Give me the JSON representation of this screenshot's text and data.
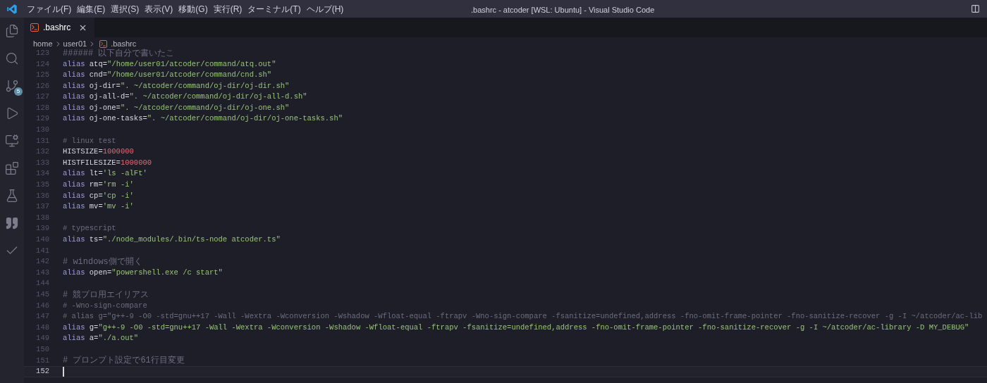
{
  "menu": [
    "ファイル(F)",
    "編集(E)",
    "選択(S)",
    "表示(V)",
    "移動(G)",
    "実行(R)",
    "ターミナル(T)",
    "ヘルプ(H)"
  ],
  "window": {
    "title": ".bashrc - atcoder [WSL: Ubuntu] - Visual Studio Code"
  },
  "activity_bar": [
    {
      "kind": "files"
    },
    {
      "kind": "search"
    },
    {
      "kind": "source-control",
      "badge": "5"
    },
    {
      "kind": "run"
    },
    {
      "kind": "remote"
    },
    {
      "kind": "extensions"
    },
    {
      "kind": "flask"
    },
    {
      "kind": "quote"
    },
    {
      "kind": "check"
    }
  ],
  "tabs": [
    {
      "label": ".bashrc",
      "selected": true
    }
  ],
  "breadcrumb": [
    "home",
    "user01",
    ".bashrc"
  ],
  "lines": [
    {
      "number": "123",
      "current": false,
      "tokens": [
        {
          "kind": "comment",
          "text": "###### 以下自分で書いたこ"
        }
      ]
    },
    {
      "number": "124",
      "current": false,
      "tokens": [
        {
          "kind": "keyword",
          "text": "alias"
        },
        {
          "kind": "name",
          "text": " atq="
        },
        {
          "kind": "string",
          "text": "\"/home/user01/atcoder/command/atq.out\""
        }
      ]
    },
    {
      "number": "125",
      "current": false,
      "tokens": [
        {
          "kind": "keyword",
          "text": "alias"
        },
        {
          "kind": "name",
          "text": " cnd="
        },
        {
          "kind": "string",
          "text": "\"/home/user01/atcoder/command/cnd.sh\""
        }
      ]
    },
    {
      "number": "126",
      "current": false,
      "tokens": [
        {
          "kind": "keyword",
          "text": "alias"
        },
        {
          "kind": "name",
          "text": " oj-dir="
        },
        {
          "kind": "string",
          "text": "\". ~/atcoder/command/oj-dir/oj-dir.sh\""
        }
      ]
    },
    {
      "number": "127",
      "current": false,
      "tokens": [
        {
          "kind": "keyword",
          "text": "alias"
        },
        {
          "kind": "name",
          "text": " oj-all-d="
        },
        {
          "kind": "string",
          "text": "\". ~/atcoder/command/oj-dir/oj-all-d.sh\""
        }
      ]
    },
    {
      "number": "128",
      "current": false,
      "tokens": [
        {
          "kind": "keyword",
          "text": "alias"
        },
        {
          "kind": "name",
          "text": " oj-one="
        },
        {
          "kind": "string",
          "text": "\". ~/atcoder/command/oj-dir/oj-one.sh\""
        }
      ]
    },
    {
      "number": "129",
      "current": false,
      "tokens": [
        {
          "kind": "keyword",
          "text": "alias"
        },
        {
          "kind": "name",
          "text": " oj-one-tasks="
        },
        {
          "kind": "string",
          "text": "\". ~/atcoder/command/oj-dir/oj-one-tasks.sh\""
        }
      ]
    },
    {
      "number": "130",
      "current": false
    },
    {
      "number": "131",
      "current": false,
      "tokens": [
        {
          "kind": "comment",
          "text": "# linux test"
        }
      ]
    },
    {
      "number": "132",
      "current": false,
      "tokens": [
        {
          "kind": "name",
          "text": "HISTSIZE="
        },
        {
          "kind": "number",
          "text": "1000000"
        }
      ]
    },
    {
      "number": "133",
      "current": false,
      "tokens": [
        {
          "kind": "name",
          "text": "HISTFILESIZE="
        },
        {
          "kind": "number",
          "text": "1000000"
        }
      ]
    },
    {
      "number": "134",
      "current": false,
      "tokens": [
        {
          "kind": "keyword",
          "text": "alias"
        },
        {
          "kind": "name",
          "text": " lt="
        },
        {
          "kind": "string",
          "text": "'ls -alFt'"
        }
      ]
    },
    {
      "number": "135",
      "current": false,
      "tokens": [
        {
          "kind": "keyword",
          "text": "alias"
        },
        {
          "kind": "name",
          "text": " rm="
        },
        {
          "kind": "string",
          "text": "'rm -i'"
        }
      ]
    },
    {
      "number": "136",
      "current": false,
      "tokens": [
        {
          "kind": "keyword",
          "text": "alias"
        },
        {
          "kind": "name",
          "text": " cp="
        },
        {
          "kind": "string",
          "text": "'cp -i'"
        }
      ]
    },
    {
      "number": "137",
      "current": false,
      "tokens": [
        {
          "kind": "keyword",
          "text": "alias"
        },
        {
          "kind": "name",
          "text": " mv="
        },
        {
          "kind": "string",
          "text": "'mv -i'"
        }
      ]
    },
    {
      "number": "138",
      "current": false
    },
    {
      "number": "139",
      "current": false,
      "tokens": [
        {
          "kind": "comment",
          "text": "# typescript"
        }
      ]
    },
    {
      "number": "140",
      "current": false,
      "tokens": [
        {
          "kind": "keyword",
          "text": "alias"
        },
        {
          "kind": "name",
          "text": " ts="
        },
        {
          "kind": "string",
          "text": "\"./node_modules/.bin/ts-node atcoder.ts\""
        }
      ]
    },
    {
      "number": "141",
      "current": false
    },
    {
      "number": "142",
      "current": false,
      "tokens": [
        {
          "kind": "comment",
          "text": "# windows側で開く"
        }
      ]
    },
    {
      "number": "143",
      "current": false,
      "tokens": [
        {
          "kind": "keyword",
          "text": "alias"
        },
        {
          "kind": "name",
          "text": " open="
        },
        {
          "kind": "string",
          "text": "\"powershell.exe /c start\""
        }
      ]
    },
    {
      "number": "144",
      "current": false
    },
    {
      "number": "145",
      "current": false,
      "tokens": [
        {
          "kind": "comment",
          "text": "# 競プロ用エイリアス"
        }
      ]
    },
    {
      "number": "146",
      "current": false,
      "tokens": [
        {
          "kind": "comment",
          "text": "# -Wno-sign-compare"
        }
      ]
    },
    {
      "number": "147",
      "current": false,
      "tokens": [
        {
          "kind": "comment",
          "text": "# alias g=\"g++-9 -O0 -std=gnu++17 -Wall -Wextra -Wconversion -Wshadow -Wfloat-equal -ftrapv -Wno-sign-compare -fsanitize=undefined,address -fno-omit-frame-pointer -fno-sanitize-recover -g -I ~/atcoder/ac-lib"
        }
      ]
    },
    {
      "number": "148",
      "current": false,
      "tokens": [
        {
          "kind": "keyword",
          "text": "alias"
        },
        {
          "kind": "name",
          "text": " g="
        },
        {
          "kind": "string",
          "text": "\"g++-9 -O0 -std=gnu++17 -Wall -Wextra -Wconversion -Wshadow -Wfloat-equal -ftrapv -fsanitize=undefined,address -fno-omit-frame-pointer -fno-sanitize-recover -g -I ~/atcoder/ac-library -D MY_DEBUG\""
        }
      ]
    },
    {
      "number": "149",
      "current": false,
      "tokens": [
        {
          "kind": "keyword",
          "text": "alias"
        },
        {
          "kind": "name",
          "text": " a="
        },
        {
          "kind": "string",
          "text": "\"./a.out\""
        }
      ]
    },
    {
      "number": "150",
      "current": false
    },
    {
      "number": "151",
      "current": false,
      "tokens": [
        {
          "kind": "comment",
          "text": "# プロンプト設定で61行目変更"
        }
      ]
    },
    {
      "number": "152",
      "current": true
    }
  ]
}
